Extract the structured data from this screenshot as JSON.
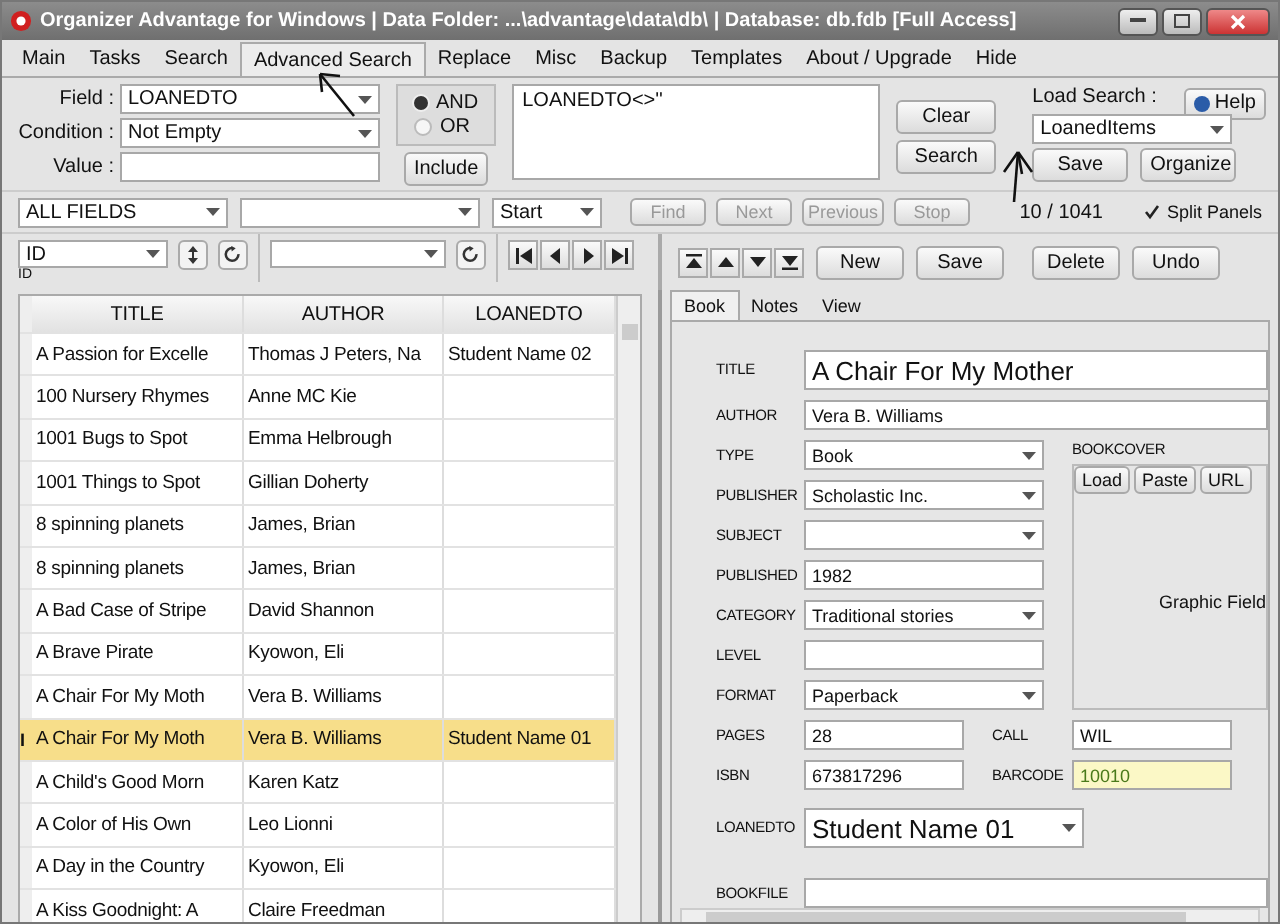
{
  "window": {
    "title": "Organizer Advantage for Windows | Data Folder: ...\\advantage\\data\\db\\ | Database: db.fdb [Full Access]"
  },
  "menu_tabs": [
    {
      "label": "Main",
      "selected": false
    },
    {
      "label": "Tasks",
      "selected": false
    },
    {
      "label": "Search",
      "selected": false
    },
    {
      "label": "Advanced Search",
      "selected": true
    },
    {
      "label": "Replace",
      "selected": false
    },
    {
      "label": "Misc",
      "selected": false
    },
    {
      "label": "Backup",
      "selected": false
    },
    {
      "label": "Templates",
      "selected": false
    },
    {
      "label": "About / Upgrade",
      "selected": false
    },
    {
      "label": "Hide",
      "selected": false
    }
  ],
  "search": {
    "field": {
      "label": "Field :",
      "value": "LOANEDTO"
    },
    "condition": {
      "label": "Condition :",
      "value": "Not Empty"
    },
    "value_field": {
      "label": "Value :"
    },
    "logic": [
      {
        "label": "AND",
        "selected": true
      },
      {
        "label": "OR",
        "selected": false
      }
    ],
    "include_button": "Include",
    "query": "LOANEDTO<>''",
    "buttons": [
      "Clear",
      "Search"
    ],
    "load_search": {
      "label": "Load Search :",
      "value": "LoanedItems"
    },
    "help_button": "Help",
    "save_button": "Save",
    "organize_button": "Organize"
  },
  "find_bar": {
    "scope": "ALL FIELDS",
    "position": "Start",
    "buttons": [
      {
        "label": "Find",
        "disabled": true
      },
      {
        "label": "Next",
        "disabled": true
      },
      {
        "label": "Previous",
        "disabled": true
      },
      {
        "label": "Stop",
        "disabled": true
      }
    ],
    "record_count": "10 / 1041",
    "split_panels": {
      "label": "Split Panels",
      "checked": true
    }
  },
  "grid_toolbar": {
    "sort_field": "ID",
    "sort_caption": "ID"
  },
  "record_toolbar": {
    "buttons": [
      "New",
      "Save",
      "Delete",
      "Undo"
    ]
  },
  "table": {
    "columns": [
      "TITLE",
      "AUTHOR",
      "LOANEDTO"
    ],
    "current_marker": "I",
    "rows": [
      {
        "cells": [
          "A Passion for Excelle",
          "Thomas J Peters, Na",
          "Student Name 02"
        ],
        "selected": false
      },
      {
        "cells": [
          "100 Nursery Rhymes",
          "Anne MC Kie",
          ""
        ],
        "selected": false
      },
      {
        "cells": [
          "1001 Bugs to Spot",
          "Emma Helbrough",
          ""
        ],
        "selected": false
      },
      {
        "cells": [
          "1001 Things to Spot",
          "Gillian Doherty",
          ""
        ],
        "selected": false
      },
      {
        "cells": [
          "8 spinning planets",
          "James, Brian",
          ""
        ],
        "selected": false
      },
      {
        "cells": [
          "8 spinning planets",
          "James, Brian",
          ""
        ],
        "selected": false
      },
      {
        "cells": [
          "A Bad Case of Stripe",
          "David Shannon",
          ""
        ],
        "selected": false
      },
      {
        "cells": [
          "A Brave Pirate",
          "Kyowon, Eli",
          ""
        ],
        "selected": false
      },
      {
        "cells": [
          "A Chair For My Moth",
          "Vera B. Williams",
          ""
        ],
        "selected": false
      },
      {
        "cells": [
          "A Chair For My Moth",
          "Vera B. Williams",
          "Student Name 01"
        ],
        "selected": true
      },
      {
        "cells": [
          "A Child's Good Morn",
          "Karen Katz",
          ""
        ],
        "selected": false
      },
      {
        "cells": [
          "A Color of His Own",
          "Leo Lionni",
          ""
        ],
        "selected": false
      },
      {
        "cells": [
          "A Day in the Country",
          "Kyowon, Eli",
          ""
        ],
        "selected": false
      },
      {
        "cells": [
          "A Kiss Goodnight: A",
          "Claire Freedman",
          ""
        ],
        "selected": false
      }
    ]
  },
  "form": {
    "tabs": [
      {
        "label": "Book",
        "selected": true
      },
      {
        "label": "Notes",
        "selected": false
      },
      {
        "label": "View",
        "selected": false
      }
    ],
    "top_fields": [
      {
        "label": "TITLE",
        "value": "A Chair For My Mother",
        "kind": "large"
      },
      {
        "label": "AUTHOR",
        "value": "Vera B. Williams",
        "kind": "text"
      }
    ],
    "left_fields": [
      {
        "label": "TYPE",
        "value": "Book",
        "kind": "dropdown"
      },
      {
        "label": "PUBLISHER",
        "value": "Scholastic Inc.",
        "kind": "dropdown"
      },
      {
        "label": "SUBJECT",
        "kind": "dropdown"
      },
      {
        "label": "PUBLISHED",
        "value": "1982",
        "kind": "text"
      },
      {
        "label": "CATEGORY",
        "value": "Traditional stories",
        "kind": "dropdown"
      },
      {
        "label": "LEVEL",
        "kind": "text"
      },
      {
        "label": "FORMAT",
        "value": "Paperback",
        "kind": "dropdown"
      }
    ],
    "bookcover": {
      "label": "BOOKCOVER",
      "buttons": [
        "Load",
        "Paste",
        "URL"
      ],
      "placeholder": "Graphic Field"
    },
    "pair_fields": [
      {
        "label": "PAGES",
        "value": "28",
        "highlighted": false
      },
      {
        "label": "CALL",
        "value": "WIL",
        "highlighted": false
      },
      {
        "label": "ISBN",
        "value": "673817296",
        "highlighted": false
      },
      {
        "label": "BARCODE",
        "value": "10010",
        "highlighted": true
      }
    ],
    "bottom_fields": [
      {
        "label": "LOANEDTO",
        "value": "Student Name 01",
        "kind": "large-dropdown"
      },
      {
        "label": "BOOKFILE",
        "kind": "text"
      }
    ]
  }
}
